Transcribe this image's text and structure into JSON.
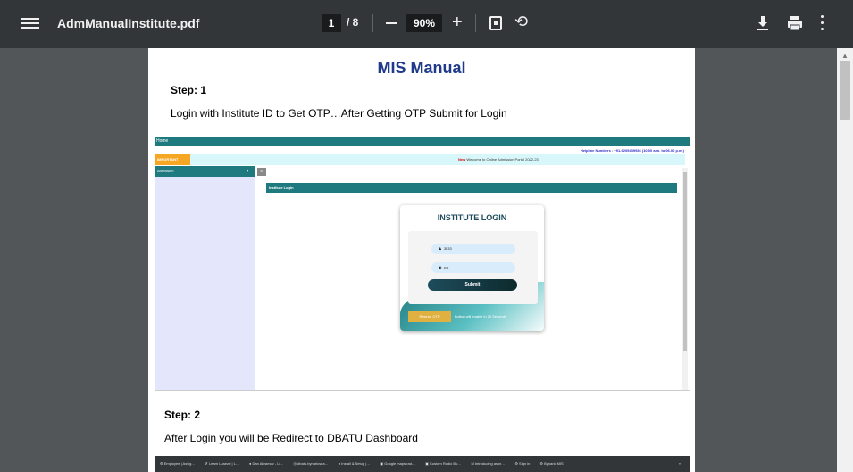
{
  "toolbar": {
    "title": "AdmManualInstitute.pdf",
    "page_current": "1",
    "page_total": "/ 8",
    "zoom": "90%"
  },
  "document": {
    "title": "MIS Manual",
    "step1_heading": "Step: 1",
    "step1_desc": "Login with Institute ID to Get OTP…After Getting OTP Submit for Login",
    "step2_heading": "Step: 2",
    "step2_desc": "After Login you will be Redirect to DBATU Dashboard"
  },
  "screenshot": {
    "home": "Home",
    "helpline": "Helpline Numbers : +91-9209439936   (10.00 a.m. to 06.00 p.m.)",
    "important": "IMPORTANT",
    "welcome_new": "New",
    "welcome": "Welcome to Online Admission Portal 2022-23",
    "admission": "Admission",
    "admission_caret": "▾",
    "toggle": "≡",
    "institute_bar": "Institute Login",
    "login_title": "INSTITUTE LOGIN",
    "user_icon": "♟",
    "user_value": "3033",
    "pass_icon": "◉",
    "pass_value": "••••",
    "submit": "Submit",
    "resend": "Resend OTP",
    "resend_note": "Button will enable in 29 Seconds"
  },
  "bookmarks": {
    "items": [
      "⚙ Employee | Assig…",
      "✗ Learn Laravel | L…",
      "● Dan Abramov - Li…",
      "◎ dbatu.bynaricsea…",
      "● Install & Setup |…",
      "▣ Google maps rad…",
      "▣ Custom Radio Bu…",
      "M Introducing asyn…",
      "⚙ Sign in",
      "⚙ Bynaric MIS"
    ],
    "more": "»"
  },
  "scrollbar": {
    "up_arrow": "▲"
  }
}
